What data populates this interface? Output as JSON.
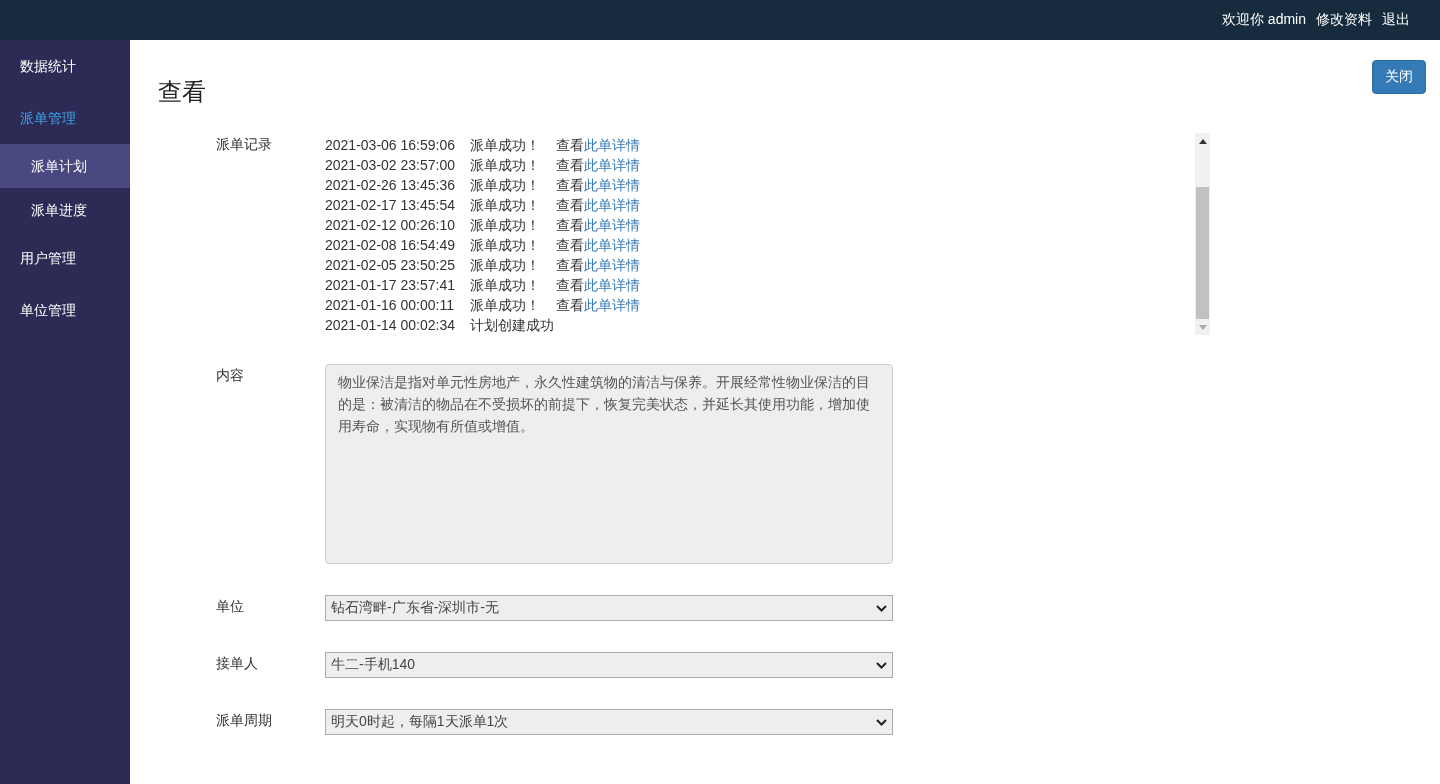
{
  "header": {
    "welcome": "欢迎你 admin",
    "links": [
      "修改资料",
      "退出"
    ]
  },
  "sidebar": {
    "items": [
      {
        "label": "数据统计",
        "expanded": false
      },
      {
        "label": "派单管理",
        "expanded": true,
        "children": [
          {
            "label": "派单计划",
            "selected": true
          },
          {
            "label": "派单进度",
            "selected": false
          }
        ]
      },
      {
        "label": "用户管理",
        "expanded": false
      },
      {
        "label": "单位管理",
        "expanded": false
      }
    ]
  },
  "page": {
    "title": "查看",
    "close_button": "关闭"
  },
  "records": {
    "label": "派单记录",
    "rows": [
      {
        "time": "2021-03-06 16:59:06",
        "message": "派单成功！",
        "prefix": "查看",
        "link": "此单详情"
      },
      {
        "time": "2021-03-02 23:57:00",
        "message": "派单成功！",
        "prefix": "查看",
        "link": "此单详情"
      },
      {
        "time": "2021-02-26 13:45:36",
        "message": "派单成功！",
        "prefix": "查看",
        "link": "此单详情"
      },
      {
        "time": "2021-02-17 13:45:54",
        "message": "派单成功！",
        "prefix": "查看",
        "link": "此单详情"
      },
      {
        "time": "2021-02-12 00:26:10",
        "message": "派单成功！",
        "prefix": "查看",
        "link": "此单详情"
      },
      {
        "time": "2021-02-08 16:54:49",
        "message": "派单成功！",
        "prefix": "查看",
        "link": "此单详情"
      },
      {
        "time": "2021-02-05 23:50:25",
        "message": "派单成功！",
        "prefix": "查看",
        "link": "此单详情"
      },
      {
        "time": "2021-01-17 23:57:41",
        "message": "派单成功！",
        "prefix": "查看",
        "link": "此单详情"
      },
      {
        "time": "2021-01-16 00:00:11",
        "message": "派单成功！",
        "prefix": "查看",
        "link": "此单详情"
      },
      {
        "time": "2021-01-14 00:02:34",
        "message": "计划创建成功"
      }
    ]
  },
  "fields": [
    {
      "kind": "textarea",
      "label": "内容",
      "value": "物业保洁是指对单元性房地产，永久性建筑物的清洁与保养。开展经常性物业保洁的目的是：被清洁的物品在不受损坏的前提下，恢复完美状态，并延长其使用功能，增加使用寿命，实现物有所值或增值。",
      "disabled": true
    },
    {
      "kind": "select",
      "label": "单位",
      "value": "钻石湾畔-广东省-深圳市-无",
      "disabled": true
    },
    {
      "kind": "select",
      "label": "接单人",
      "value": "牛二-手机140",
      "disabled": true
    },
    {
      "kind": "select",
      "label": "派单周期",
      "value": "明天0时起，每隔1天派单1次",
      "disabled": true
    }
  ]
}
